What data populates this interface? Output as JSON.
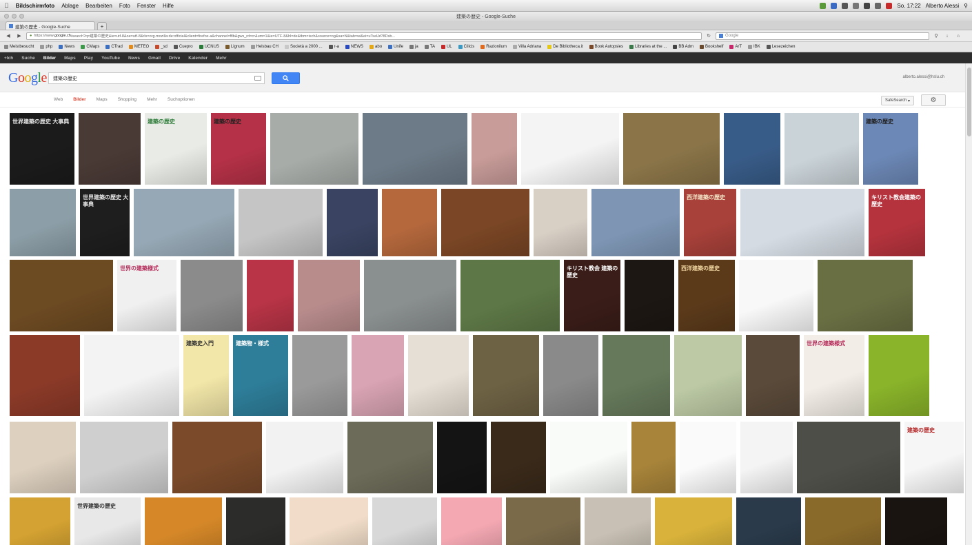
{
  "menubar": {
    "app": "Bildschirmfoto",
    "items": [
      "Ablage",
      "Bearbeiten",
      "Foto",
      "Fenster",
      "Hilfe"
    ],
    "clock": "So. 17:22",
    "user": "Alberto Alessi"
  },
  "window": {
    "title": "建築の歴史 - Google-Suche"
  },
  "tab": {
    "label": "建築の歴史 - Google-Suche"
  },
  "navbar": {
    "url_prefix": "https://www.",
    "url_host": "google.ch",
    "url_rest": "/search?q=建築の歴史&ie=utf-8&oe=utf-8&rls=org.mozilla:de:official&client=firefox-a&channel=fflb&gws_rd=cr&um=1&ie=UTF-8&hl=de&tbm=isch&source=og&sa=N&tab=wi&ei=uTsaUrP8Dsb...",
    "search_placeholder": "Google"
  },
  "bookmarks": [
    {
      "label": "Meistbesucht",
      "color": "#888888"
    },
    {
      "label": "php",
      "color": "#999999"
    },
    {
      "label": "News",
      "color": "#3b6fc4"
    },
    {
      "label": "CMaps",
      "color": "#3b9a4a"
    },
    {
      "label": "CTrad",
      "color": "#3b6fc4"
    },
    {
      "label": "METEO",
      "color": "#e38b1a"
    },
    {
      "label": "_sd",
      "color": "#c84a2a"
    },
    {
      "label": "Cuepro",
      "color": "#555555"
    },
    {
      "label": "UCNUS",
      "color": "#2a7a3a"
    },
    {
      "label": "Lignum",
      "color": "#7a5a2a"
    },
    {
      "label": "Helsbau CH",
      "color": "#999999"
    },
    {
      "label": "Società a 2000 ...",
      "color": "#c8c8c8"
    },
    {
      "label": "r-a",
      "color": "#555555"
    },
    {
      "label": "NEWS",
      "color": "#2a4ac4"
    },
    {
      "label": "abo",
      "color": "#e3a81a"
    },
    {
      "label": "Unife",
      "color": "#3b6fc4"
    },
    {
      "label": "ja",
      "color": "#777777"
    },
    {
      "label": "TA",
      "color": "#777777"
    },
    {
      "label": "UL",
      "color": "#c42a2a"
    },
    {
      "label": "Cilicis",
      "color": "#3b9ac4"
    },
    {
      "label": "Razionilum",
      "color": "#e36a1a"
    },
    {
      "label": "Villa Adriana",
      "color": "#aaaaaa"
    },
    {
      "label": "De Bibliotheca.it",
      "color": "#e3c81a"
    },
    {
      "label": "Book Autopsies",
      "color": "#7a4a2a"
    },
    {
      "label": "Libraries at the ...",
      "color": "#3a7a4a"
    },
    {
      "label": "BB Adm",
      "color": "#444444"
    },
    {
      "label": "Bookshelf",
      "color": "#6a4a2a"
    },
    {
      "label": "ArT",
      "color": "#c42a6a"
    },
    {
      "label": "IBK",
      "color": "#999999"
    },
    {
      "label": "Lesezeichen",
      "color": "#555555"
    }
  ],
  "gbar": {
    "items": [
      "+Ich",
      "Suche",
      "Bilder",
      "Maps",
      "Play",
      "YouTube",
      "News",
      "Gmail",
      "Drive",
      "Kalender",
      "Mehr"
    ],
    "active_index": 2
  },
  "search": {
    "query": "建築の歴史",
    "account": "alberto.alessi@hslu.ch"
  },
  "result_tabs": {
    "items": [
      "Web",
      "Bilder",
      "Maps",
      "Shopping",
      "Mehr",
      "Suchoptionen"
    ],
    "active_index": 1,
    "safesearch": "SafeSearch"
  },
  "images": [
    [
      {
        "bg": "#1b1b1b",
        "text": "世界建築の歴史 大事典",
        "fg": "#e6e6e6"
      },
      {
        "bg": "#4a3a36"
      },
      {
        "bg": "#e9ece6",
        "text": "建築の歴史",
        "fg": "#2e7c3a"
      },
      {
        "bg": "#b53147",
        "text": "建築の歴史",
        "fg": "#222222"
      },
      {
        "bg": "#a7aca9"
      },
      {
        "bg": "#6d7b88"
      },
      {
        "bg": "#c89c99"
      },
      {
        "bg": "#f4f4f4"
      },
      {
        "bg": "#8a7448"
      },
      {
        "bg": "#385c88"
      },
      {
        "bg": "#cad3d8"
      },
      {
        "bg": "#6c88b6",
        "text": "建築の歴史",
        "fg": "#202020"
      }
    ],
    [
      {
        "bg": "#8c9ea7"
      },
      {
        "bg": "#1e1e1e",
        "text": "世界建築の歴史 大事典",
        "fg": "#e6e6e6"
      },
      {
        "bg": "#96a8b5"
      },
      {
        "bg": "#c5c5c5"
      },
      {
        "bg": "#3a4462"
      },
      {
        "bg": "#b5683c"
      },
      {
        "bg": "#7a4625"
      },
      {
        "bg": "#d8cfc5"
      },
      {
        "bg": "#7e96b4"
      },
      {
        "bg": "#a8413a",
        "text": "西洋建築の歴史",
        "fg": "#f4e7c9"
      },
      {
        "bg": "#d4dbe2"
      },
      {
        "bg": "#b5333d",
        "text": "キリスト教会建築の歴史",
        "fg": "#ffffff"
      }
    ],
    [
      {
        "bg": "#6c4a22"
      },
      {
        "bg": "#f0f0f0",
        "text": "世界の建築様式",
        "fg": "#b52a5a"
      },
      {
        "bg": "#8b8b8b"
      },
      {
        "bg": "#b83446"
      },
      {
        "bg": "#b98c8c"
      },
      {
        "bg": "#8a8f90"
      },
      {
        "bg": "#5d7746"
      },
      {
        "bg": "#3a1d18",
        "text": "キリスト教会 建築の歴史",
        "fg": "#ffffff"
      },
      {
        "bg": "#1d1713"
      },
      {
        "bg": "#5b3a1a",
        "text": "西洋建築の歴史",
        "fg": "#f0d7a0"
      },
      {
        "bg": "#f8f8f8"
      },
      {
        "bg": "#6a6f43"
      }
    ],
    [
      {
        "bg": "#8c3a28"
      },
      {
        "bg": "#f3f3f3"
      },
      {
        "bg": "#f2e6a8",
        "text": "建築史入門",
        "fg": "#333333"
      },
      {
        "bg": "#2e7e9a",
        "text": "建築物・様式",
        "fg": "#ffffff"
      },
      {
        "bg": "#9a9a9a"
      },
      {
        "bg": "#d9a4b4"
      },
      {
        "bg": "#e6dfd5"
      },
      {
        "bg": "#6e6244"
      },
      {
        "bg": "#8a8a8a"
      },
      {
        "bg": "#66795a"
      },
      {
        "bg": "#bcc9a4"
      },
      {
        "bg": "#5a4a3a"
      },
      {
        "bg": "#f2ede6",
        "text": "世界の建築様式",
        "fg": "#b52a5a"
      },
      {
        "bg": "#8ab42a"
      }
    ],
    [
      {
        "bg": "#ddd0bf"
      },
      {
        "bg": "#cfcfcf"
      },
      {
        "bg": "#7a4a2a"
      },
      {
        "bg": "#f2f2f2"
      },
      {
        "bg": "#6c6a58"
      },
      {
        "bg": "#141414"
      },
      {
        "bg": "#3a2a1a"
      },
      {
        "bg": "#f8fbf8"
      },
      {
        "bg": "#a8843a"
      },
      {
        "bg": "#fafafa"
      },
      {
        "bg": "#f4f4f4"
      },
      {
        "bg": "#4e4e48"
      },
      {
        "bg": "#f6f6f6",
        "text": "建築の歴史",
        "fg": "#b52a2a"
      }
    ],
    [
      {
        "bg": "#d4a232"
      },
      {
        "bg": "#e8e8e8",
        "text": "世界建築の歴史",
        "fg": "#333333"
      },
      {
        "bg": "#d68828"
      },
      {
        "bg": "#2c2c2a"
      },
      {
        "bg": "#f0dcc8"
      },
      {
        "bg": "#d8d8d8"
      },
      {
        "bg": "#f4a8b2"
      },
      {
        "bg": "#7a6a4a"
      },
      {
        "bg": "#c8c0b4"
      },
      {
        "bg": "#d8b23a"
      },
      {
        "bg": "#2a3a4a"
      },
      {
        "bg": "#8a6a2a"
      },
      {
        "bg": "#1a1410"
      }
    ]
  ]
}
